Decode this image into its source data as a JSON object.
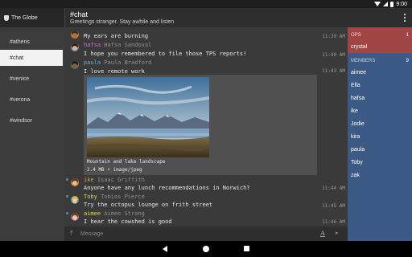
{
  "status_bar": {
    "time": "9:00"
  },
  "drawer": {
    "server_name": "The Globe",
    "channels": [
      "#athens",
      "#chat",
      "#venice",
      "#verona",
      "#windsor"
    ],
    "active_channel": "#chat"
  },
  "toolbar": {
    "title": "#chat",
    "topic": "Greetings stranger. Stay awhile and listen"
  },
  "messages": [
    {
      "nick": "",
      "real_name": "",
      "text": "My ears are burning",
      "time": "11:39 AM"
    },
    {
      "nick": "hafsa",
      "real_name": "Hafsa Sandoval",
      "text": "I hope you remembered to file those TPS reports!",
      "time": "11:40 AM"
    },
    {
      "nick": "paula",
      "real_name": "Paula Bradford",
      "text": "I love remote work",
      "time": "11:43 AM"
    },
    {
      "nick": "ike",
      "real_name": "Isaac Griffith",
      "text": "Anyone have any lunch recommendations in Norwich?",
      "time": "11:44 AM"
    },
    {
      "nick": "Toby",
      "real_name": "Tobias Pierce",
      "text": "Try the octopus lounge on frith street",
      "time": "11:45 AM"
    },
    {
      "nick": "aimee",
      "real_name": "Aimee Strong",
      "text": "I hear the cowshed is good",
      "time": "11:46 AM"
    }
  ],
  "attachment": {
    "caption": "Mountain and lake landscape",
    "meta": "2.4 MB • image/jpeg"
  },
  "composer": {
    "placeholder": "Message"
  },
  "members": {
    "ops_label": "OPS",
    "ops_count": "1",
    "ops": [
      "crystal"
    ],
    "members_label": "MEMBERS",
    "members_count": "9",
    "list": [
      "aimee",
      "Ella",
      "hafsa",
      "ike",
      "Jodie",
      "kira",
      "paula",
      "Toby",
      "zak"
    ]
  },
  "colors": {
    "accent": "#3c5a86",
    "ops_bg": "#a04646",
    "nick_hafsa": "#d46ad4",
    "nick_paula": "#5fb0d8",
    "nick_ike": "#e0a020",
    "nick_toby": "#e6d850",
    "nick_aimee": "#e6d850"
  }
}
